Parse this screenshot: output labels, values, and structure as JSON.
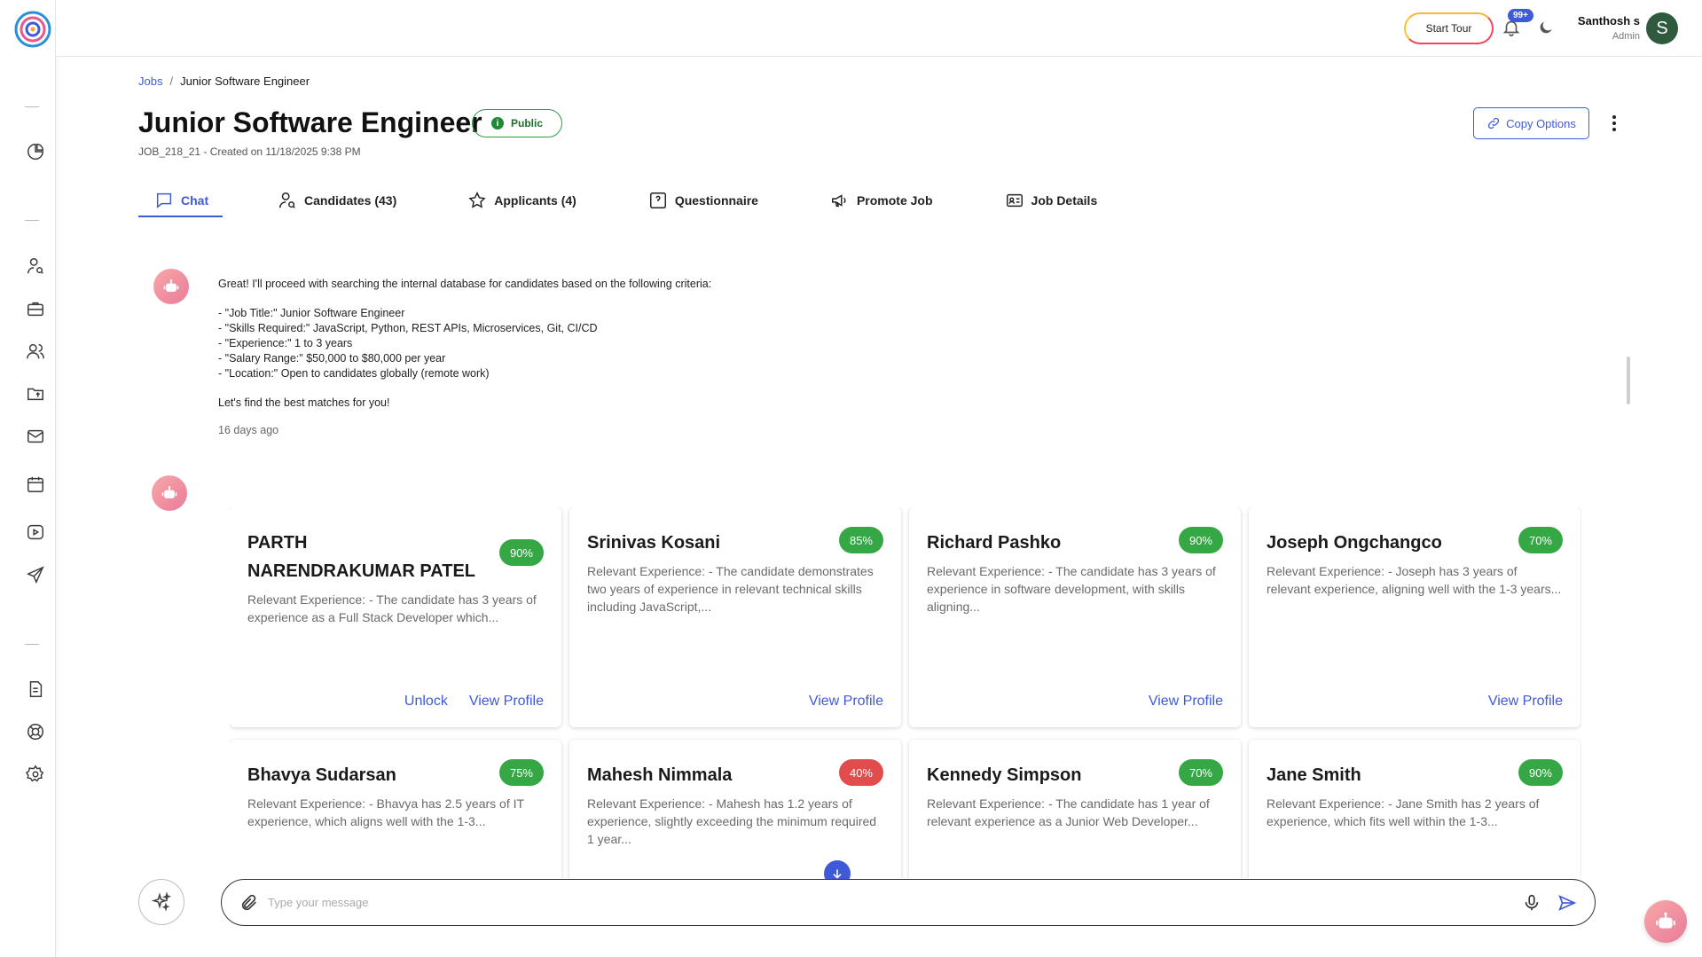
{
  "header": {
    "tour_label": "Start Tour",
    "notif_count": "99+",
    "user_name": "Santhosh s",
    "user_role": "Admin",
    "avatar_letter": "S"
  },
  "breadcrumb": {
    "parent": "Jobs",
    "separator": "/",
    "current": "Junior Software Engineer"
  },
  "job": {
    "title": "Junior Software Engineer",
    "visibility": "Public",
    "meta": "JOB_218_21 - Created on 11/18/2025 9:38 PM",
    "copy_label": "Copy Options"
  },
  "tabs": [
    {
      "label": "Chat",
      "icon": "chat-icon",
      "active": true
    },
    {
      "label": "Candidates (43)",
      "icon": "candidate-search-icon"
    },
    {
      "label": "Applicants (4)",
      "icon": "star-icon"
    },
    {
      "label": "Questionnaire",
      "icon": "question-icon"
    },
    {
      "label": "Promote Job",
      "icon": "megaphone-icon"
    },
    {
      "label": "Job Details",
      "icon": "id-card-icon"
    }
  ],
  "message": {
    "intro": "Great! I'll proceed with searching the internal database for candidates based on the following criteria:",
    "criteria": [
      "- \"Job Title:\" Junior Software Engineer",
      "- \"Skills Required:\" JavaScript, Python, REST APIs, Microservices, Git, CI/CD",
      "- \"Experience:\" 1 to 3 years",
      "- \"Salary Range:\" $50,000 to $80,000 per year",
      "- \"Location:\" Open to candidates globally (remote work)"
    ],
    "outro": "Let's find the best matches for you!",
    "time": "16 days ago"
  },
  "candidates": [
    {
      "name": "PARTH NARENDRAKUMAR PATEL",
      "score": "90%",
      "desc": "Relevant Experience: - The candidate has 3 years of experience as a Full Stack Developer which...",
      "unlock": "Unlock",
      "view": "View Profile"
    },
    {
      "name": "Srinivas Kosani",
      "score": "85%",
      "desc": "Relevant Experience: - The candidate demonstrates two years of experience in relevant technical skills including JavaScript,...",
      "view": "View Profile"
    },
    {
      "name": "Richard Pashko",
      "score": "90%",
      "desc": "Relevant Experience: - The candidate has 3 years of experience in software development, with skills aligning...",
      "view": "View Profile"
    },
    {
      "name": "Joseph Ongchangco",
      "score": "70%",
      "desc": "Relevant Experience: - Joseph has 3 years of relevant experience, aligning well with the 1-3 years...",
      "view": "View Profile"
    },
    {
      "name": "Bhavya Sudarsan",
      "score": "75%",
      "desc": "Relevant Experience: - Bhavya has 2.5 years of IT experience, which aligns well with the 1-3..."
    },
    {
      "name": "Mahesh Nimmala",
      "score": "40%",
      "desc": "Relevant Experience: - Mahesh has 1.2 years of experience, slightly exceeding the minimum required 1 year..."
    },
    {
      "name": "Kennedy Simpson",
      "score": "70%",
      "desc": "Relevant Experience: - The candidate has 1 year of relevant experience as a Junior Web Developer..."
    },
    {
      "name": "Jane Smith",
      "score": "90%",
      "desc": "Relevant Experience: - Jane Smith has 2 years of experience, which fits well within the 1-3..."
    }
  ],
  "chat_input": {
    "placeholder": "Type your message"
  },
  "colors": {
    "accent": "#3f5ad8",
    "score_good": "#35a845",
    "score_low": "#e24c4c"
  }
}
